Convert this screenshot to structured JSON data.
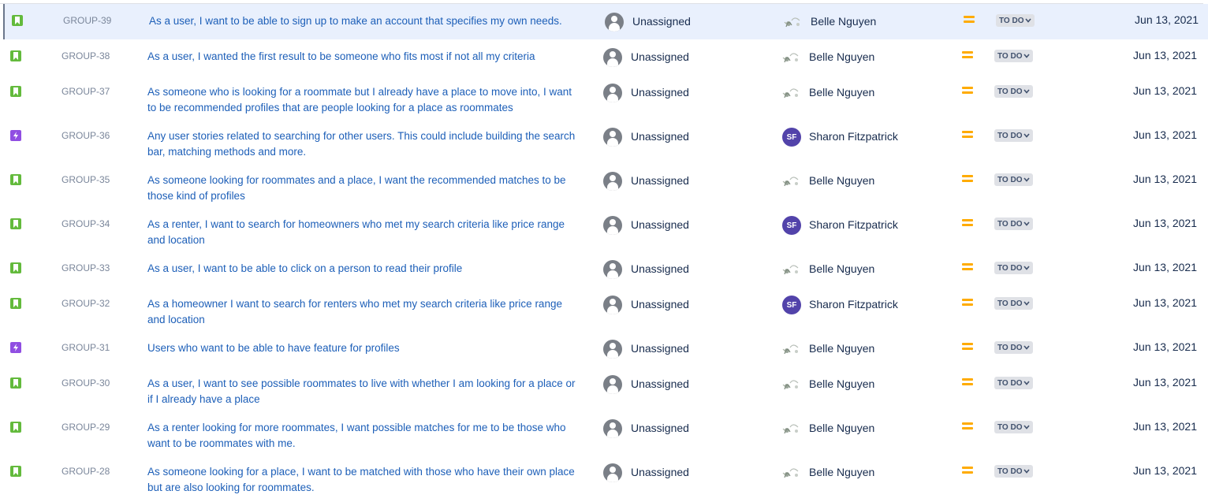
{
  "colors": {
    "story": "#63ba3c",
    "epic": "#904ee2",
    "link": "#1d5fb8",
    "priority_medium": "#ffab00",
    "selected_row": "#e9f0fd"
  },
  "rows": [
    {
      "type": "story",
      "key": "GROUP-39",
      "summary": [
        "As a user, I want to be able to sign up to make an account that specifies my own needs."
      ],
      "assignee": "Unassigned",
      "reporter": "Belle Nguyen",
      "reporter_avatar": "photo",
      "priority": "medium",
      "status": "TO DO",
      "created": "Jun 13, 2021",
      "selected": true
    },
    {
      "type": "story",
      "key": "GROUP-38",
      "summary": [
        "As a user, I wanted the first result to be someone who fits most if not all my criteria"
      ],
      "assignee": "Unassigned",
      "reporter": "Belle Nguyen",
      "reporter_avatar": "photo",
      "priority": "medium",
      "status": "TO DO",
      "created": "Jun 13, 2021"
    },
    {
      "type": "story",
      "key": "GROUP-37",
      "summary": [
        "As someone who is looking for a roommate but I already have a place to move into, I want",
        "to be recommended profiles that are people looking for a place as roommates"
      ],
      "assignee": "Unassigned",
      "reporter": "Belle Nguyen",
      "reporter_avatar": "photo",
      "priority": "medium",
      "status": "TO DO",
      "created": "Jun 13, 2021"
    },
    {
      "type": "epic",
      "key": "GROUP-36",
      "summary": [
        "Any user stories related to searching for other users. This could include building the search",
        "bar, matching methods and more."
      ],
      "assignee": "Unassigned",
      "reporter": "Sharon Fitzpatrick",
      "reporter_avatar": "SF",
      "priority": "medium",
      "status": "TO DO",
      "created": "Jun 13, 2021"
    },
    {
      "type": "story",
      "key": "GROUP-35",
      "summary": [
        "As someone looking for roommates and a place, I want the recommended matches to be",
        "those kind of profiles"
      ],
      "assignee": "Unassigned",
      "reporter": "Belle Nguyen",
      "reporter_avatar": "photo",
      "priority": "medium",
      "status": "TO DO",
      "created": "Jun 13, 2021"
    },
    {
      "type": "story",
      "key": "GROUP-34",
      "summary": [
        "As a renter, I want to search for homeowners who met my search criteria like price range",
        "and location"
      ],
      "assignee": "Unassigned",
      "reporter": "Sharon Fitzpatrick",
      "reporter_avatar": "SF",
      "priority": "medium",
      "status": "TO DO",
      "created": "Jun 13, 2021"
    },
    {
      "type": "story",
      "key": "GROUP-33",
      "summary": [
        "As a user, I want to be able to click on a person to read their profile"
      ],
      "assignee": "Unassigned",
      "reporter": "Belle Nguyen",
      "reporter_avatar": "photo",
      "priority": "medium",
      "status": "TO DO",
      "created": "Jun 13, 2021"
    },
    {
      "type": "story",
      "key": "GROUP-32",
      "summary": [
        "As a homeowner I want to search for renters who met my search criteria like price range",
        "and location"
      ],
      "assignee": "Unassigned",
      "reporter": "Sharon Fitzpatrick",
      "reporter_avatar": "SF",
      "priority": "medium",
      "status": "TO DO",
      "created": "Jun 13, 2021"
    },
    {
      "type": "epic",
      "key": "GROUP-31",
      "summary": [
        "Users who want to be able to have feature for profiles"
      ],
      "assignee": "Unassigned",
      "reporter": "Belle Nguyen",
      "reporter_avatar": "photo",
      "priority": "medium",
      "status": "TO DO",
      "created": "Jun 13, 2021"
    },
    {
      "type": "story",
      "key": "GROUP-30",
      "summary": [
        "As a user, I want to see possible roommates to live with whether I am looking for a place or",
        "if I already have a place"
      ],
      "assignee": "Unassigned",
      "reporter": "Belle Nguyen",
      "reporter_avatar": "photo",
      "priority": "medium",
      "status": "TO DO",
      "created": "Jun 13, 2021"
    },
    {
      "type": "story",
      "key": "GROUP-29",
      "summary": [
        "As a renter looking for more roommates, I want possible matches for me to be those who",
        "want to be roommates with me."
      ],
      "assignee": "Unassigned",
      "reporter": "Belle Nguyen",
      "reporter_avatar": "photo",
      "priority": "medium",
      "status": "TO DO",
      "created": "Jun 13, 2021"
    },
    {
      "type": "story",
      "key": "GROUP-28",
      "summary": [
        "As someone looking for a place, I want to be matched with those who have their own place",
        "but are also looking for roommates."
      ],
      "assignee": "Unassigned",
      "reporter": "Belle Nguyen",
      "reporter_avatar": "photo",
      "priority": "medium",
      "status": "TO DO",
      "created": "Jun 13, 2021"
    }
  ]
}
